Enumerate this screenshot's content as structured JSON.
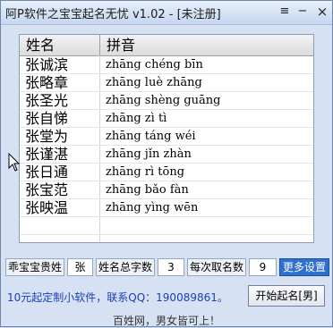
{
  "window": {
    "title": "阿P软件之宝宝起名无忧 v1.02 - [未注册]"
  },
  "titlebar_buttons": {
    "menu": "≡",
    "minimize": "−",
    "close": "×"
  },
  "table": {
    "headers": [
      "姓名",
      "拼音"
    ],
    "rows": [
      {
        "name": "张诚滨",
        "pinyin": "zhāng chéng bīn"
      },
      {
        "name": "张略章",
        "pinyin": "zhāng luè zhāng"
      },
      {
        "name": "张圣光",
        "pinyin": "zhāng shèng guāng"
      },
      {
        "name": "张自悌",
        "pinyin": "zhāng zì tì"
      },
      {
        "name": "张堂为",
        "pinyin": "zhāng táng wéi"
      },
      {
        "name": "张谨湛",
        "pinyin": "zhāng jǐn zhàn"
      },
      {
        "name": "张日通",
        "pinyin": "zhāng rì tōng"
      },
      {
        "name": "张宝范",
        "pinyin": "zhāng bǎo fàn"
      },
      {
        "name": "张映温",
        "pinyin": "zhāng yìng wēn"
      }
    ]
  },
  "settings": {
    "surname_label": "乖宝宝贵姓",
    "surname_value": "张",
    "total_chars_label": "姓名总字数",
    "total_chars_value": "3",
    "per_batch_label": "每次取名数",
    "per_batch_value": "9",
    "more_settings": "更多设置"
  },
  "promo_link": "10元起定制小软件，联系QQ：190089861。",
  "start_button": "开始起名[男]",
  "footer": "百姓网，男女皆可上！",
  "colors": {
    "accent": "#2e6fd0",
    "link": "#1a3fb8",
    "window_bg": "#d6e2f3"
  },
  "icons": {
    "cursor": "arrow-cursor-icon"
  }
}
